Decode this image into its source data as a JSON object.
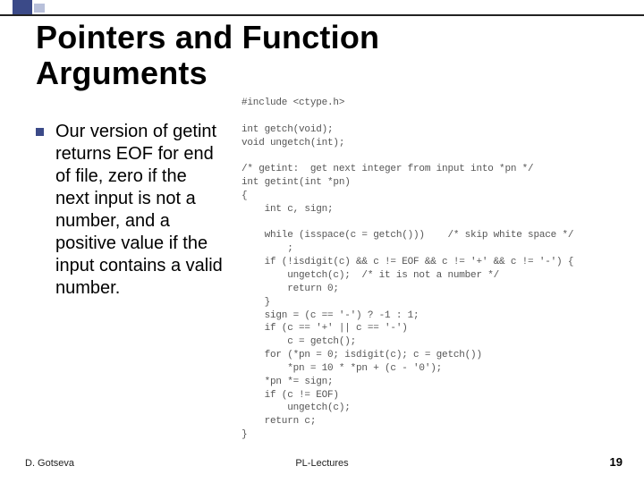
{
  "title_line1": "Pointers and Function",
  "title_line2": "Arguments",
  "bullet": "Our version of getint returns EOF for end of file, zero if the next input is not a number, and a positive value if the input contains a valid number.",
  "code": "#include <ctype.h>\n\nint getch(void);\nvoid ungetch(int);\n\n/* getint:  get next integer from input into *pn */\nint getint(int *pn)\n{\n    int c, sign;\n\n    while (isspace(c = getch()))    /* skip white space */\n        ;\n    if (!isdigit(c) && c != EOF && c != '+' && c != '-') {\n        ungetch(c);  /* it is not a number */\n        return 0;\n    }\n    sign = (c == '-') ? -1 : 1;\n    if (c == '+' || c == '-')\n        c = getch();\n    for (*pn = 0; isdigit(c); c = getch())\n        *pn = 10 * *pn + (c - '0');\n    *pn *= sign;\n    if (c != EOF)\n        ungetch(c);\n    return c;\n}",
  "footer": {
    "author": "D. Gotseva",
    "center": "PL-Lectures",
    "page": "19"
  }
}
